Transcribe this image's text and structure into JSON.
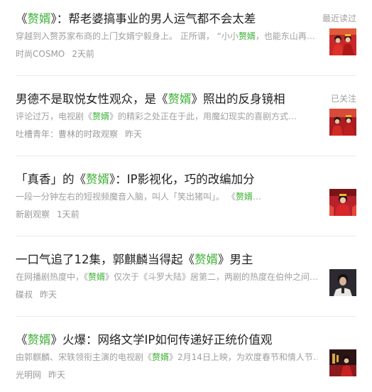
{
  "items": [
    {
      "title_pre": "《",
      "title_hl": "赘婿",
      "title_post": "》：帮老婆搞事业的男人运气都不会太差",
      "snippet_pre": "穿越到入赘苏家布商的上门女婿宁毅身上。 正所谓， “小小",
      "snippet_hl": "赘婿",
      "snippet_post": "，也能东山再…",
      "source": "时尚COSMO",
      "time": "2天前",
      "tag": "最近读过",
      "thumb_icon": "red-wedding-photo-thumbnail"
    },
    {
      "title_pre": "男德不是取悦女性观众，是《",
      "title_hl": "赘婿",
      "title_post": "》照出的反身镜相",
      "snippet_pre": "评论过万，电视剧《",
      "snippet_hl": "赘婿",
      "snippet_post": "》的精彩之处正在于此，用魔幻现实的喜剧方式…",
      "source": "吐槽青年：曹林的时政观察",
      "time": "昨天",
      "tag": "已关注",
      "thumb_icon": "red-wedding-couple-thumbnail"
    },
    {
      "title_pre": "「真香」的《",
      "title_hl": "赘婿",
      "title_post": "》：IP影视化，巧的改编加分",
      "snippet_pre": "一段一分钟左右的短视频魔音入脑，叫人「笑出猪叫」。 《",
      "snippet_hl": "赘婿",
      "snippet_post": "…",
      "source": "新剧观察",
      "time": "1天前",
      "tag": "",
      "thumb_icon": "red-costume-bride-thumbnail"
    },
    {
      "title_pre": "一口气追了12集，郭麒麟当得起《",
      "title_hl": "赘婿",
      "title_post": "》男主",
      "snippet_pre": "在网播剧热度中，《",
      "snippet_hl": "赘婿",
      "snippet_post": "》仅次于《斗罗大陆》居第二，两剧的热度在伯仲之间…",
      "source": "碟叔",
      "time": "昨天",
      "tag": "",
      "thumb_icon": "actor-portrait-thumbnail"
    },
    {
      "title_pre": "《",
      "title_hl": "赘婿",
      "title_post": "》火爆：网络文学IP如何传递好正统价值观",
      "snippet_pre": "由郭麒麟、宋轶领衔主演的电视剧《",
      "snippet_hl": "赘婿",
      "snippet_post": "》2月14日上映，为欢度春节和情人节…",
      "source": "光明网",
      "time": "昨天",
      "tag": "",
      "thumb_icon": "drama-poster-thumbnail"
    }
  ],
  "colors": {
    "highlight": "#3cb034",
    "title": "#222222",
    "muted": "#a0a0a0"
  }
}
